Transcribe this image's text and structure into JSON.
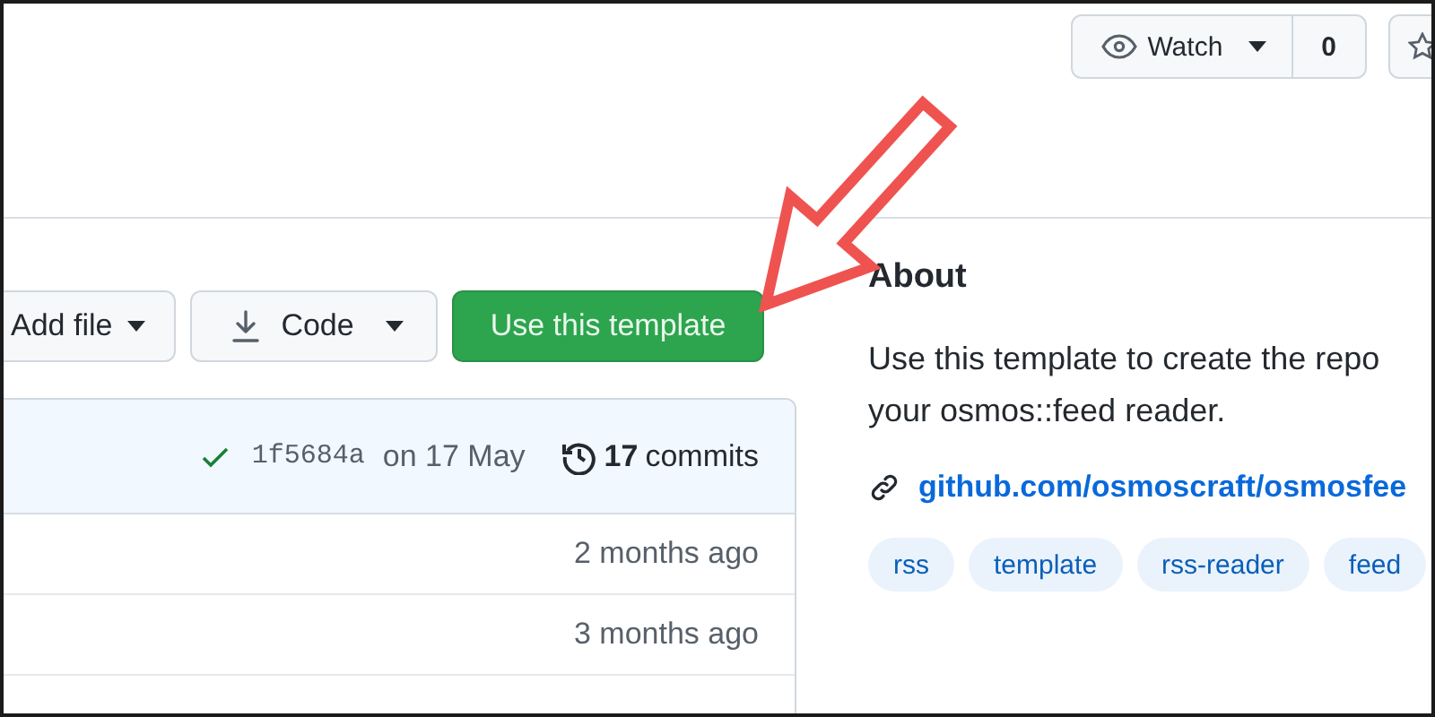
{
  "header": {
    "watch": {
      "label": "Watch",
      "count": "0"
    }
  },
  "actions": [
    {
      "kind": "menu",
      "label": "Add file"
    },
    {
      "kind": "download",
      "label": "Code"
    },
    {
      "kind": "primary",
      "label": "Use this template"
    }
  ],
  "commit_bar": {
    "sha": "1f5684a",
    "date": "on 17 May",
    "count": "17",
    "count_label": "commits"
  },
  "files": [
    {
      "age": "2 months ago"
    },
    {
      "age": "3 months ago"
    }
  ],
  "about": {
    "title": "About",
    "description_lines": [
      "Use this template to create the repo",
      "your osmos::feed reader."
    ],
    "link": "github.com/osmoscraft/osmosfee",
    "topics": [
      "rss",
      "template",
      "rss-reader",
      "feed"
    ]
  },
  "annotation": {
    "kind": "arrow"
  }
}
